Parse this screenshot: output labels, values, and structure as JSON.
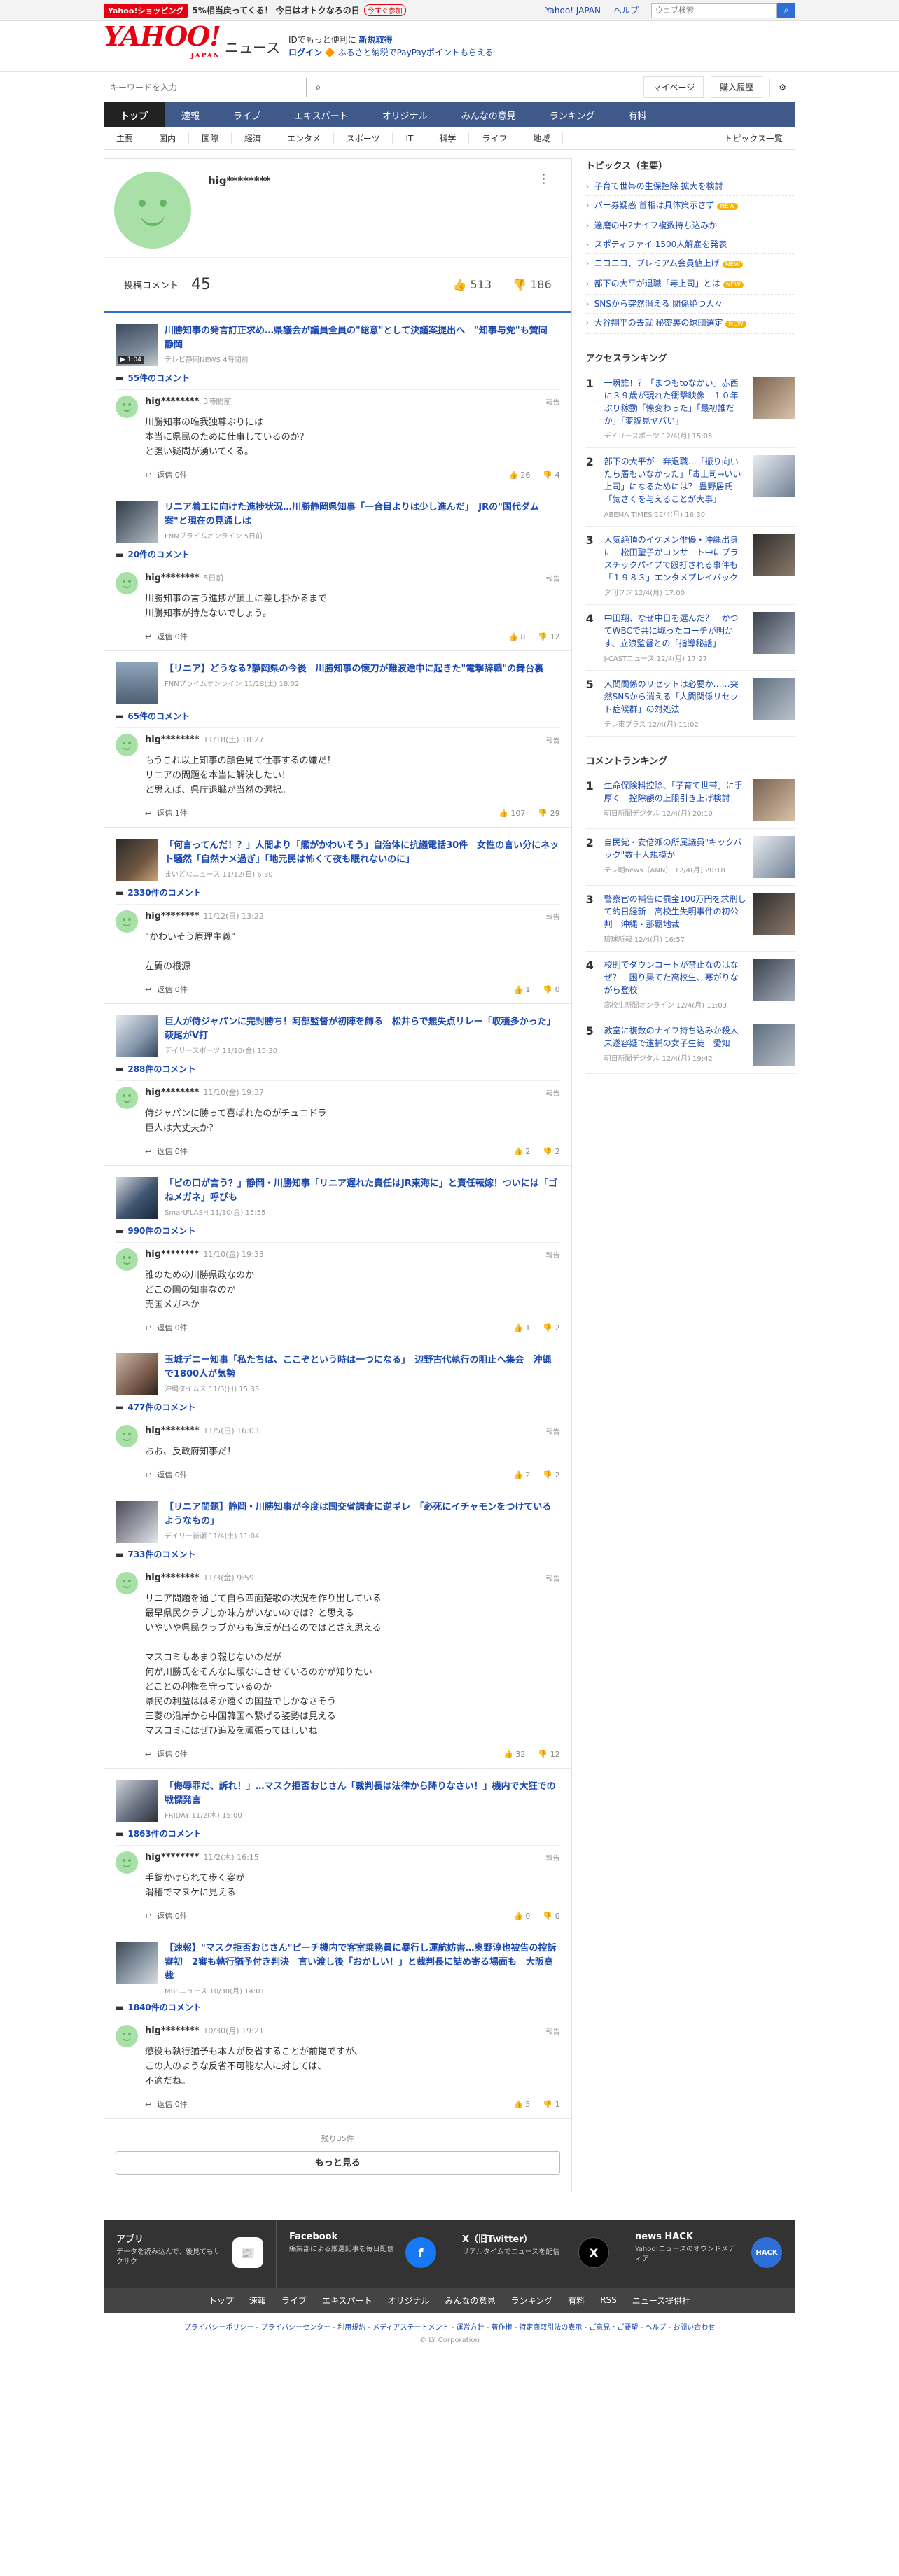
{
  "topbar": {
    "shopping": "Yahoo!ショッピング",
    "promo": "5%相当戻ってくる！ 今日はオトクなろの日",
    "promo_btn": "今すぐ参加",
    "links": [
      "Yahoo! JAPAN",
      "ヘルプ"
    ],
    "search_placeholder": "ウェブ検索"
  },
  "brand": {
    "logo": "YAHOO!",
    "logo_sub": "JAPAN",
    "service": "ニュース",
    "msg1": "IDでもっと便利に",
    "msg1b": "新規取得",
    "msg2": "ログイン",
    "msg2b": "🔶 ふるさと納税でPayPayポイントもらえる"
  },
  "toolrow": {
    "placeholder": "キーワードを入力",
    "mypage": "マイページ",
    "history": "購入履歴"
  },
  "nav": [
    "トップ",
    "速報",
    "ライブ",
    "エキスパート",
    "オリジナル",
    "みんなの意見",
    "ランキング",
    "有料"
  ],
  "subnav": [
    "主要",
    "国内",
    "国際",
    "経済",
    "エンタメ",
    "スポーツ",
    "IT",
    "科学",
    "ライフ",
    "地域",
    "トピックス一覧"
  ],
  "profile": {
    "name": "hig********",
    "label": "投稿コメント",
    "count": "45",
    "up": "513",
    "down": "186"
  },
  "comments": [
    {
      "title": "川勝知事の発言訂正求め…県議会が議員全員の\"総意\"として決議案提出へ　\"知事与党\"も賛同　静岡",
      "src": "テレビ静岡NEWS 4時間前",
      "video": "▶ 1:04",
      "ccount": "55件のコメント",
      "user": "hig********",
      "time": "3時間前",
      "text": "川勝知事の唯我独尊ぶりには\n本当に県民のために仕事しているのか？\nと強い疑問が湧いてくる。",
      "reply": "返信 0件",
      "up": "26",
      "down": "4"
    },
    {
      "title": "リニア着工に向けた進捗状況…川勝静岡県知事「一合目よりは少し進んだ」　JRの\"国代ダム案\"と現在の見通しは",
      "src": "FNNプライムオンライン 5日前",
      "video": "",
      "ccount": "20件のコメント",
      "user": "hig********",
      "time": "5日前",
      "text": "川勝知事の言う進捗が頂上に差し掛かるまで\n川勝知事が持たないでしょう。",
      "reply": "返信 0件",
      "up": "8",
      "down": "12"
    },
    {
      "title": "【リニア】どうなる?静岡県の今後　川勝知事の懐刀が難波途中に起きた\"電撃辞職\"の舞台裏",
      "src": "FNNプライムオンライン 11/18(土) 18:02",
      "video": "",
      "ccount": "65件のコメント",
      "user": "hig********",
      "time": "11/18(土) 18:27",
      "text": "もうこれ以上知事の顔色見て仕事するの嫌だ！\nリニアの問題を本当に解決したい！\nと思えば、県庁退職が当然の選択。",
      "reply": "返信 1件",
      "up": "107",
      "down": "29"
    },
    {
      "title": "「何言ってんだ！？」人間より「熊がかわいそう」自治体に抗議電話30件　女性の言い分にネット騒然「自然ナメ過ぎ」「地元民は怖くて夜も眠れないのに」",
      "src": "まいどなニュース 11/12(日) 6:30",
      "video": "",
      "ccount": "2330件のコメント",
      "user": "hig********",
      "time": "11/12(日) 13:22",
      "text": "\"かわいそう原理主義\"\n\n左翼の根源",
      "reply": "返信 0件",
      "up": "1",
      "down": "0"
    },
    {
      "title": "巨人が侍ジャパンに完封勝ち！阿部監督が初陣を飾る　松井らで無失点リレー「収穫多かった」萩尾がV打",
      "src": "デイリースポーツ 11/10(金) 15:30",
      "video": "",
      "ccount": "288件のコメント",
      "user": "hig********",
      "time": "11/10(金) 19:37",
      "text": "侍ジャパンに勝って喜ばれたのがチュニドラ\n巨人は大丈夫か？",
      "reply": "返信 0件",
      "up": "2",
      "down": "2"
    },
    {
      "title": "「ビの口が言う？」静岡・川勝知事「リニア遅れた責任はJR東海に」と責任転嫁！ついには「ゴねメガネ」呼びも",
      "src": "SmartFLASH 11/10(金) 15:55",
      "video": "",
      "ccount": "990件のコメント",
      "user": "hig********",
      "time": "11/10(金) 19:33",
      "text": "誰のための川勝県政なのか\nどこの国の知事なのか\n売国メガネか",
      "reply": "返信 0件",
      "up": "1",
      "down": "2"
    },
    {
      "title": "玉城デニー知事「私たちは、ここぞという時は一つになる」　辺野古代執行の阻止へ集会　沖縄で1800人が気勢",
      "src": "沖縄タイムス 11/5(日) 15:33",
      "video": "",
      "ccount": "477件のコメント",
      "user": "hig********",
      "time": "11/5(日) 16:03",
      "text": "おお、反政府知事だ！",
      "reply": "返信 0件",
      "up": "2",
      "down": "2"
    },
    {
      "title": "【リニア問題】静岡・川勝知事が今度は国交省調査に逆ギレ　「必死にイチャモンをつけているようなもの」",
      "src": "デイリー新潮 11/4(土) 11:04",
      "video": "",
      "ccount": "733件のコメント",
      "user": "hig********",
      "time": "11/3(金) 9:59",
      "text": "リニア問題を通じて自ら四面楚歌の状況を作り出している\n最早県民クラブしか味方がいないのでは？と思える\nいやいや県民クラブからも造反が出るのではとさえ思える\n\nマスコミもあまり報じないのだが\n何が川勝氏をそんなに頑なにさせているのかが知りたい\nどことの利権を守っているのか\n県民の利益ははるか遠くの国益でしかなさそう\n三菱の沿岸から中国韓国へ繋げる姿勢は見える\nマスコミにはぜひ追及を頑張ってほしいね",
      "reply": "返信 0件",
      "up": "32",
      "down": "12"
    },
    {
      "title": "「侮辱罪だ、訴れ！」…マスク拒否おじさん「裁判長は法律から降りなさい！」機内で大狂での戦慄発言",
      "src": "FRIDAY 11/2(木) 15:00",
      "video": "",
      "ccount": "1863件のコメント",
      "user": "hig********",
      "time": "11/2(木) 16:15",
      "text": "手錠かけられて歩く姿が\n滑稽でマヌケに見える",
      "reply": "返信 0件",
      "up": "0",
      "down": "0"
    },
    {
      "title": "【速報】\"マスク拒否おじさん\"ピーチ機内で客室乗務員に暴行し運航妨害…奥野淳也被告の控訴審初　2審も執行猶予付き判決　言い渡し後「おかしい！」と裁判長に詰め寄る場面も　大阪高裁",
      "src": "MBSニュース 10/30(月) 14:01",
      "video": "",
      "ccount": "1840件のコメント",
      "user": "hig********",
      "time": "10/30(月) 19:21",
      "text": "懲役も執行猶予も本人が反省することが前提ですが、\nこの人のような反省不可能な人に対しては、\n不適だね。",
      "reply": "返信 0件",
      "up": "5",
      "down": "1"
    }
  ],
  "more": {
    "remaining": "残り35件",
    "label": "もっと見る"
  },
  "topics": {
    "heading": "トピックス（主要）",
    "items": [
      {
        "t": "子育て世帯の生保控除 拡大を検討",
        "n": ""
      },
      {
        "t": "パー券疑惑 首相は具体策示さず",
        "n": "NEW"
      },
      {
        "t": "達磨の中2ナイフ複数持ち込みか",
        "n": ""
      },
      {
        "t": "スポティファイ 1500人解雇を発表",
        "n": ""
      },
      {
        "t": "ニコニコ、プレミアム会員値上げ",
        "n": "NEW"
      },
      {
        "t": "部下の大平が退職「毒上司」とは",
        "n": "NEW"
      },
      {
        "t": "SNSから突然消える 関係絶つ人々",
        "n": ""
      },
      {
        "t": "大谷翔平の去就 秘密裏の球団選定",
        "n": "NEW"
      }
    ]
  },
  "access": {
    "heading": "アクセスランキング",
    "items": [
      {
        "t": "一瞬誰！？「まつもtoなかい」赤西に３９歳が現れた衝撃映像　１０年ぶり稼動「懐変わった」「最初誰だか」「変貌見ヤバい」",
        "s": "デイリースポーツ 12/4(月) 15:05"
      },
      {
        "t": "部下の大平が一奔退職…「振り向いたら層もいなかった」「毒上司→いい上司」になるためには？ 豊野居氏「気さくを与えることが大事」",
        "s": "ABEMA TIMES 12/4(月) 16:30"
      },
      {
        "t": "人気絶頂のイケメン俳優・沖縄出身に　松田聖子がコンサート中にプラスチックパイプで殴打される事件も　「１９８３」エンタメプレイバック",
        "s": "夕刊フジ 12/4(月) 17:00"
      },
      {
        "t": "中田翔、なぜ中日を選んだ？　かつてWBCで共に戦ったコーチが明かす、立浪監督との「指導秘話」",
        "s": "J-CASTニュース 12/4(月) 17:27"
      },
      {
        "t": "人間関係のリセットは必要か……突然SNSから消える「人間関係リセット症候群」の対処法",
        "s": "テレ東プラス 12/4(月) 11:02"
      }
    ]
  },
  "commentrank": {
    "heading": "コメントランキング",
    "items": [
      {
        "t": "生命保険料控除、「子育て世帯」に手厚く　控除額の上限引き上げ検討",
        "s": "朝日新聞デジタル 12/4(月) 20:10"
      },
      {
        "t": "自民党・安倍派の所属議員\"キックバック\"数十人規模か",
        "s": "テレ朝news（ANN） 12/4(月) 20:18"
      },
      {
        "t": "警察官の補告に罰金100万円を求刑して約日経新　高校生失明事件の初公判　沖縄・那覇地裁",
        "s": "琉球新報 12/4(月) 16:57"
      },
      {
        "t": "校則でダウンコートが禁止なのはなぜ？　困り果てた高校生、寒がりながら登校",
        "s": "高校生新聞オンライン 12/4(月) 11:03"
      },
      {
        "t": "教室に複数のナイフ持ち込みか殺人未遂容疑で逮捕の女子生徒　愛知",
        "s": "朝日新聞デジタル 12/4(月) 19:42"
      }
    ]
  },
  "footer": {
    "boxes": [
      {
        "h": "アプリ",
        "p": "データを読み込んで、後見てもサクサク",
        "i": "📰"
      },
      {
        "h": "Facebook",
        "p": "編集部による厳選記事を毎日配信",
        "i": "f"
      },
      {
        "h": "X（旧Twitter）",
        "p": "リアルタイムでニュースを配信",
        "i": "X"
      },
      {
        "h": "news HACK",
        "p": "Yahoo!ニュースのオウンドメディア",
        "i": "HACK"
      }
    ],
    "nav": [
      "トップ",
      "速報",
      "ライブ",
      "エキスパート",
      "オリジナル",
      "みんなの意見",
      "ランキング",
      "有料",
      "RSS",
      "ニュース提供社"
    ],
    "links": "プライバシーポリシー - プライバシーセンター - 利用規約 - メディアステートメント - 運営方針 - 著作権 - 特定商取引法の表示 - ご意見・ご要望 - ヘルプ - お問い合わせ",
    "copy": "© LY Corporation"
  }
}
